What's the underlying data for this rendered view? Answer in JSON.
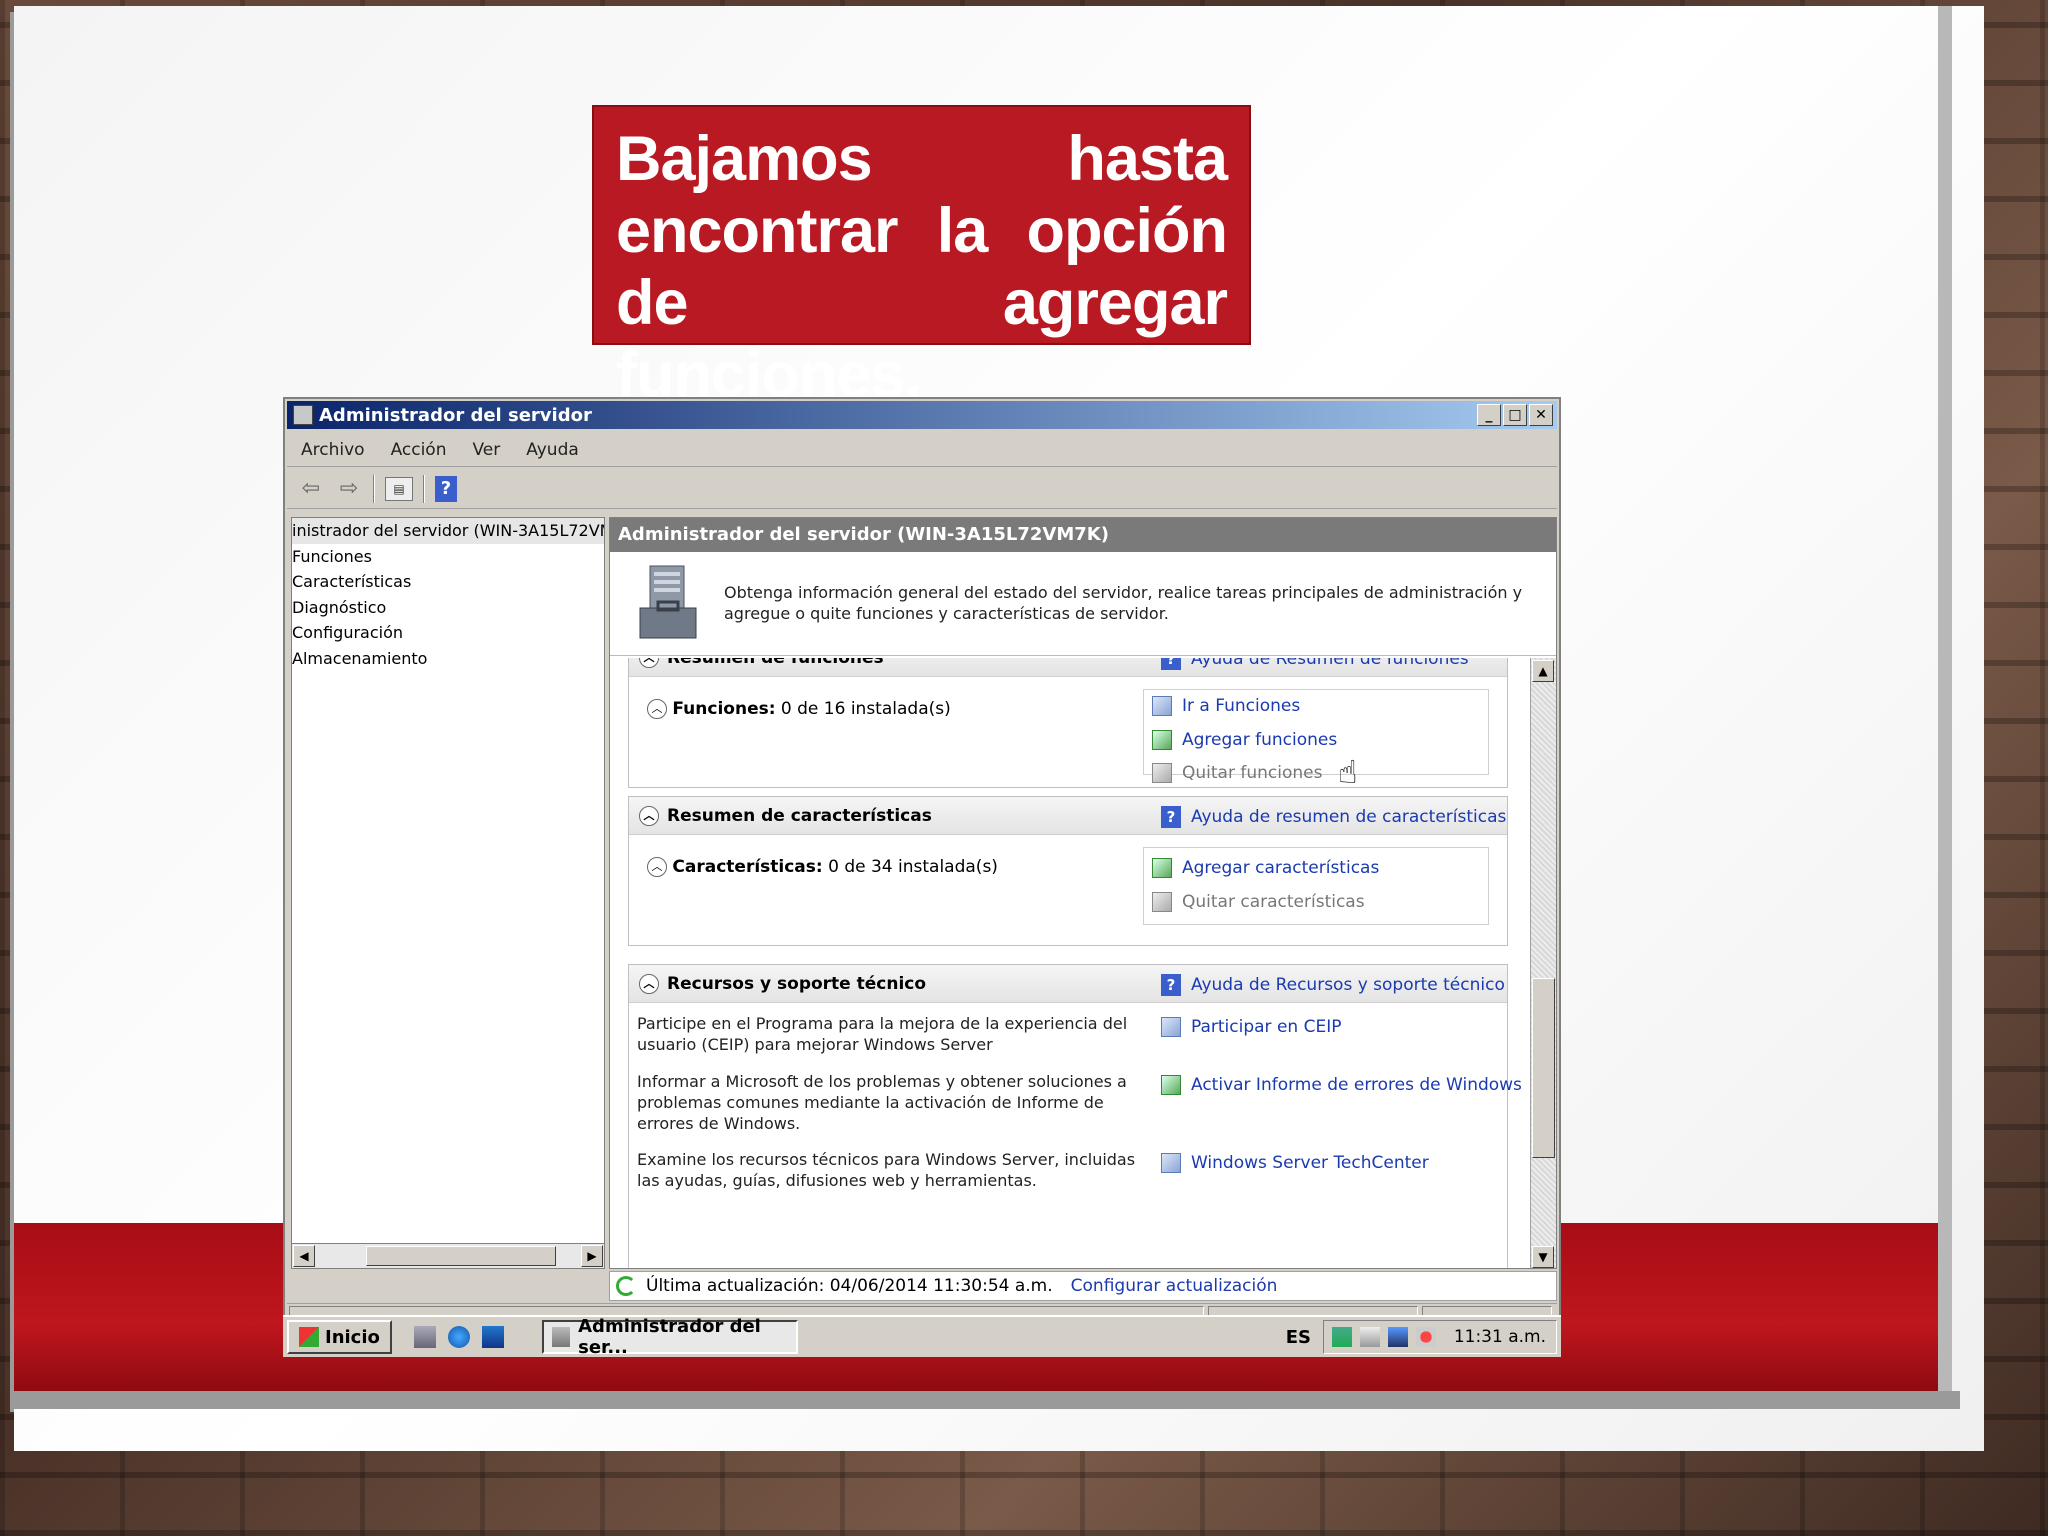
{
  "slide": {
    "callout_text": "Bajamos hasta encontrar la opción de agregar funciones."
  },
  "window": {
    "title": "Administrador del servidor",
    "buttons": {
      "minimize": "_",
      "maximize": "□",
      "close": "✕"
    },
    "menu": [
      "Archivo",
      "Acción",
      "Ver",
      "Ayuda"
    ],
    "toolbar_help": "?"
  },
  "tree": {
    "items": [
      "inistrador del servidor (WIN-3A15L72VM",
      "Funciones",
      "Características",
      "Diagnóstico",
      "Configuración",
      "Almacenamiento"
    ]
  },
  "main": {
    "header": "Administrador del servidor (WIN-3A15L72VM7K)",
    "intro": "Obtenga información general del estado del servidor, realice tareas principales de administración y agregue o quite funciones y características de servidor.",
    "roles_cut_title": "Resumen de funciones",
    "roles_cut_link": "Ayuda de Resumen de funciones",
    "roles": {
      "label": "Funciones:",
      "value": "0 de 16 instalada(s)",
      "links": [
        "Ir a Funciones",
        "Agregar funciones",
        "Quitar funciones"
      ]
    },
    "features_panel": {
      "title": "Resumen de características",
      "help": "Ayuda de resumen de características",
      "label": "Características:",
      "value": "0 de 34 instalada(s)",
      "links": [
        "Agregar características",
        "Quitar características"
      ]
    },
    "resources_panel": {
      "title": "Recursos y soporte técnico",
      "help": "Ayuda de Recursos y soporte técnico",
      "rows": [
        {
          "text": "Participe en el Programa para la mejora de la experiencia del usuario (CEIP) para mejorar Windows Server",
          "link": "Participar en CEIP"
        },
        {
          "text": "Informar a Microsoft de los problemas y obtener soluciones a problemas comunes mediante la activación de Informe de errores de Windows.",
          "link": "Activar Informe de errores de Windows"
        },
        {
          "text": "Examine los recursos técnicos para Windows Server, incluidas las ayudas, guías, difusiones web y herramientas.",
          "link": "Windows Server TechCenter"
        }
      ]
    },
    "status": {
      "last_update": "Última actualización: 04/06/2014 11:30:54 a.m.",
      "configure": "Configurar actualización"
    }
  },
  "taskbar": {
    "start": "Inicio",
    "task": "Administrador del ser...",
    "lang": "ES",
    "clock": "11:31 a.m."
  }
}
